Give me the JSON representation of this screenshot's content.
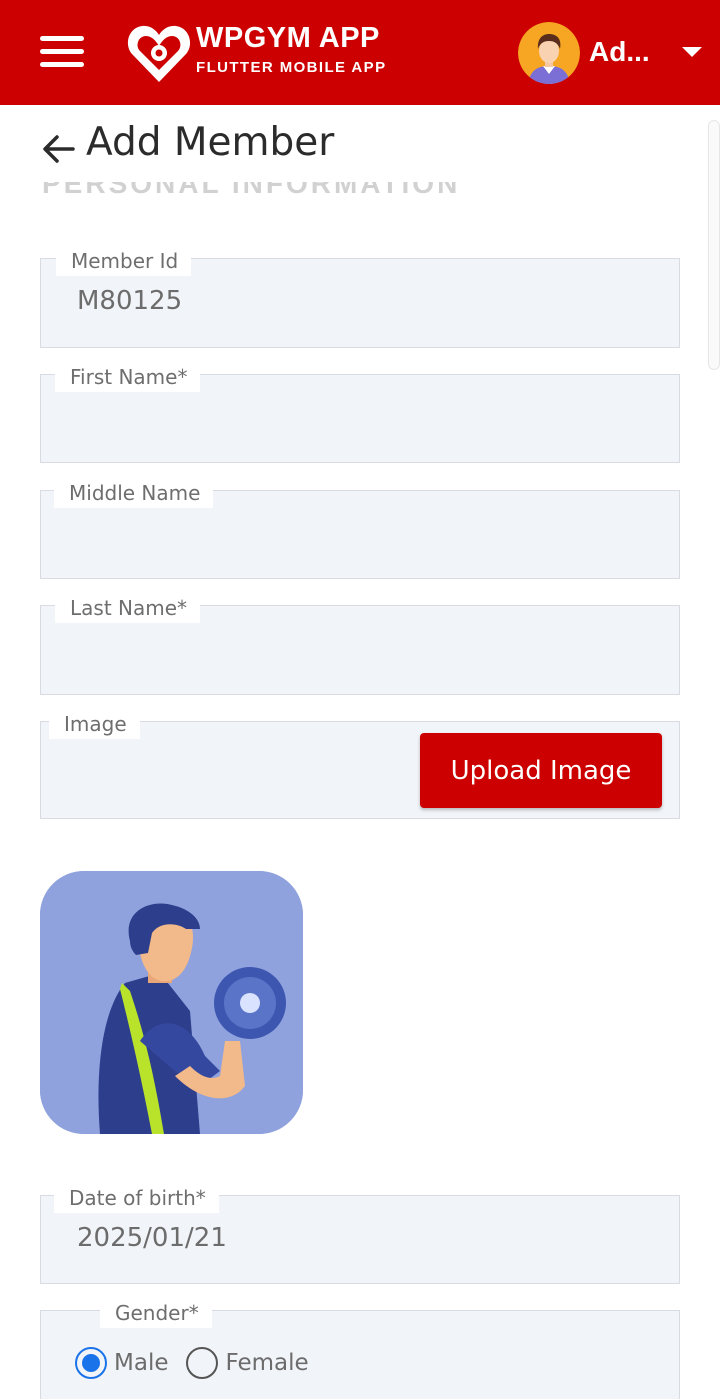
{
  "header": {
    "brand_title": "WPGYM APP",
    "brand_subtitle": "FLUTTER MOBILE APP",
    "user_name": "Ad...",
    "menu_icon": "hamburger-menu-icon",
    "dropdown_icon": "caret-down-icon",
    "colors": {
      "header_bg": "#cc0000",
      "text": "#ffffff"
    }
  },
  "page": {
    "title": "Add Member",
    "back_icon": "arrow-left-icon",
    "section_heading": "PERSONAL INFORMATION"
  },
  "form": {
    "member_id": {
      "label": "Member Id",
      "value": "M80125"
    },
    "first_name": {
      "label": "First Name*",
      "value": ""
    },
    "middle_name": {
      "label": "Middle Name",
      "value": ""
    },
    "last_name": {
      "label": "Last Name*",
      "value": ""
    },
    "image": {
      "label": "Image",
      "upload_button": "Upload Image"
    },
    "date_of_birth": {
      "label": "Date of birth*",
      "value": "2025/01/21"
    },
    "gender": {
      "label": "Gender*",
      "options": [
        "Male",
        "Female"
      ],
      "selected": "Male"
    }
  },
  "colors": {
    "accent": "#cc0000",
    "field_bg": "#f1f4f8",
    "radio_selected": "#1a73e8"
  }
}
